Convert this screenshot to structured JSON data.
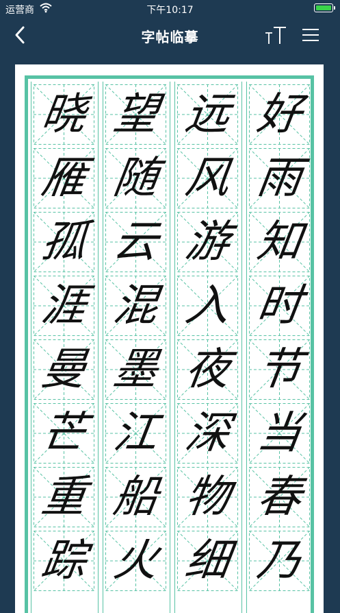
{
  "status_bar": {
    "carrier": "运营商",
    "time": "下午10:17",
    "battery_level": 1.0
  },
  "nav": {
    "title": "字帖临摹",
    "back_icon": "chevron-left-icon",
    "font_size_icon": "text-size-icon",
    "menu_icon": "hamburger-menu-icon"
  },
  "colors": {
    "background": "#1e3a52",
    "grid_border": "#57c2a4",
    "grid_dash": "#57c2a4",
    "ink": "#111111",
    "battery": "#3ad34a"
  },
  "columns": [
    {
      "chars": [
        "晓",
        "雁",
        "孤",
        "涯",
        "曼",
        "芒",
        "重",
        "踪"
      ]
    },
    {
      "chars": [
        "望",
        "随",
        "云",
        "混",
        "墨",
        "江",
        "船",
        "火"
      ]
    },
    {
      "chars": [
        "远",
        "风",
        "游",
        "入",
        "夜",
        "深",
        "物",
        "细"
      ]
    },
    {
      "chars": [
        "好",
        "雨",
        "知",
        "时",
        "节",
        "当",
        "春",
        "乃"
      ]
    }
  ]
}
